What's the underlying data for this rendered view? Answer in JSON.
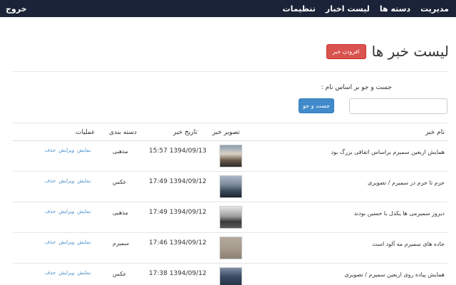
{
  "navbar": {
    "items": [
      "مدیریت",
      "دسته ها",
      "لیست اخبار",
      "تنظیمات"
    ],
    "logout": "خروج"
  },
  "header": {
    "title": "لیست خبر ها",
    "add_button": "افزودن خبر"
  },
  "search": {
    "label": "جست و جو بر اساس نام :",
    "placeholder": "",
    "button": "جست و جو"
  },
  "table": {
    "columns": [
      "نام خبر",
      "تصویر خبر",
      "تاریخ خبر",
      "دسته بندی",
      "عملیات"
    ],
    "operations": [
      "نمایش",
      "ویرایش",
      "حذف"
    ],
    "rows": [
      {
        "name": "همایش اربعین سمیرم براساس اتفاقی بزرگ بود",
        "date": "1394/09/13 15:57",
        "category": "مذهبی"
      },
      {
        "name": "حرم تا حرم در سمیرم / تصویری",
        "date": "1394/09/12 17:49",
        "category": "عکس"
      },
      {
        "name": "دیروز سمیرمی ها یکدل با حسین بودند",
        "date": "1394/09/12 17:49",
        "category": "مذهبی"
      },
      {
        "name": "جاده های سمیرم مه آلود است",
        "date": "1394/09/12 17:46",
        "category": "سمیرم"
      },
      {
        "name": "همایش پیاده روی اربعین سمیرم / تصویری",
        "date": "1394/09/12 17:38",
        "category": "عکس"
      }
    ]
  }
}
